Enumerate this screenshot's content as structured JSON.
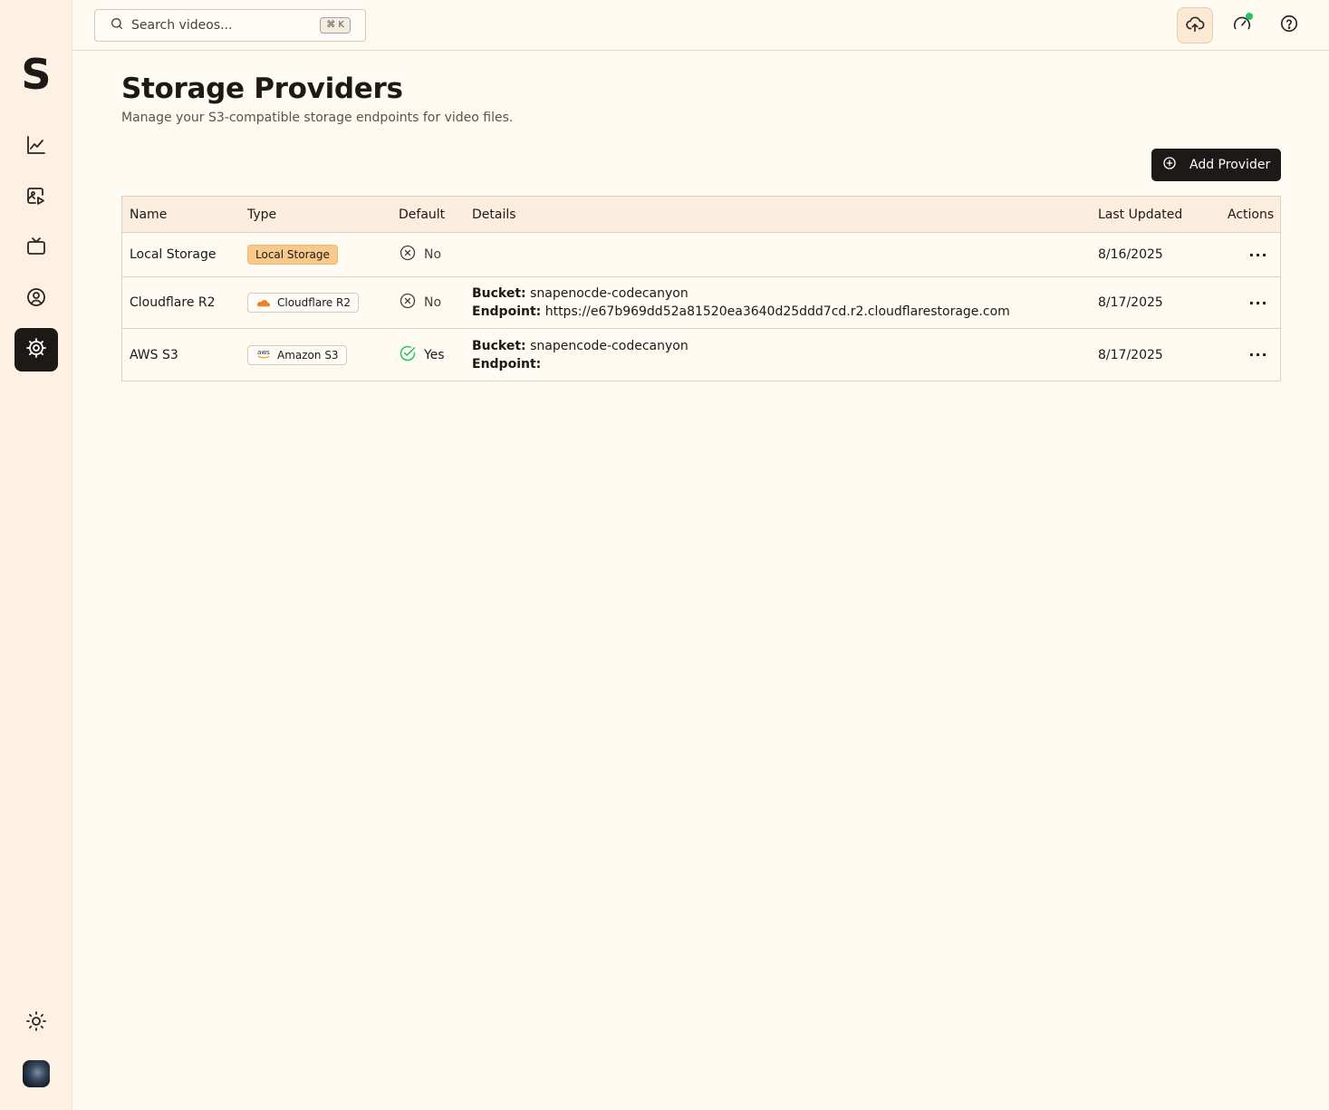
{
  "app": {
    "logo_letter": "S"
  },
  "sidebar": {
    "items": [
      {
        "icon": "chart-line-icon",
        "label": "Analytics",
        "active": false
      },
      {
        "icon": "video-library-icon",
        "label": "Videos",
        "active": false
      },
      {
        "icon": "tv-icon",
        "label": "Channels",
        "active": false
      },
      {
        "icon": "user-circle-icon",
        "label": "Account",
        "active": false
      },
      {
        "icon": "gear-icon",
        "label": "Settings",
        "active": true
      }
    ],
    "theme_icon": "sun-icon",
    "avatar": "user-avatar"
  },
  "topbar": {
    "search_placeholder": "Search videos...",
    "search_shortcut": "⌘ K",
    "icons": [
      "upload-cloud-icon",
      "speedometer-icon",
      "help-circle-icon"
    ]
  },
  "page": {
    "title": "Storage Providers",
    "subtitle": "Manage your S3-compatible storage endpoints for video files.",
    "add_button": "Add Provider"
  },
  "table": {
    "columns": [
      "Name",
      "Type",
      "Default",
      "Details",
      "Last Updated",
      "Actions"
    ],
    "rows": [
      {
        "name": "Local Storage",
        "type": "Local Storage",
        "type_icon": "",
        "default": "No",
        "bucket_label": "",
        "bucket": "",
        "endpoint_label": "",
        "endpoint": "",
        "updated": "8/16/2025",
        "actions": "···"
      },
      {
        "name": "Cloudflare R2",
        "type": "Cloudflare R2",
        "type_icon": "cloudflare-icon",
        "default": "No",
        "bucket_label": "Bucket:",
        "bucket": "snapenocde-codecanyon",
        "endpoint_label": "Endpoint:",
        "endpoint": "https://e67b969dd52a81520ea3640d25ddd7cd.r2.cloudflarestorage.com",
        "updated": "8/17/2025",
        "actions": "···"
      },
      {
        "name": "AWS S3",
        "type": "Amazon S3",
        "type_icon": "aws-icon",
        "type_icon_text": "aws",
        "default": "Yes",
        "bucket_label": "Bucket:",
        "bucket": "snapencode-codecanyon",
        "endpoint_label": "Endpoint:",
        "endpoint": "",
        "updated": "8/17/2025",
        "actions": "···"
      }
    ]
  },
  "colors": {
    "background": "#fffaf2",
    "sidebar": "#fdf1e3",
    "accent_dark": "#1c1917",
    "badge_local": "#f8c98b",
    "success": "#22c55e",
    "cloudflare": "#f38020"
  }
}
